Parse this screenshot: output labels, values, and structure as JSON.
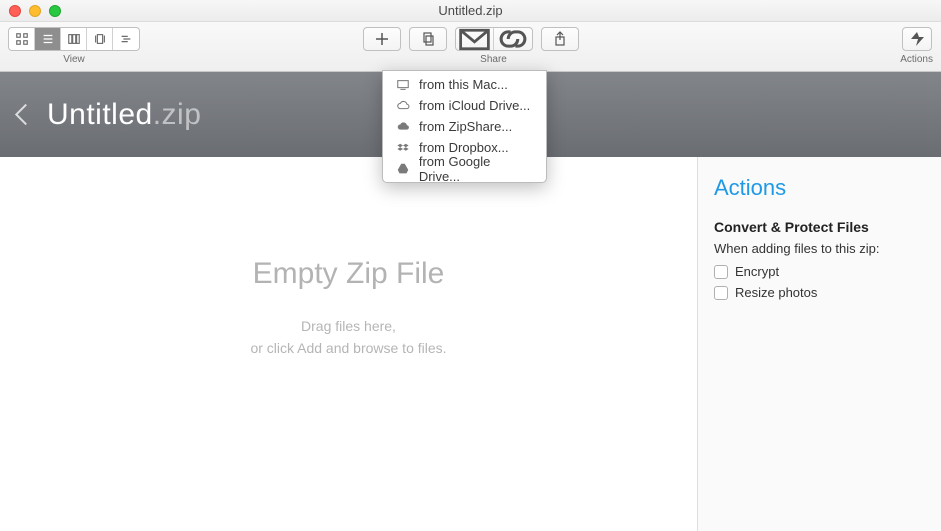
{
  "window_title": "Untitled.zip",
  "toolbar": {
    "view_label": "View",
    "share_label": "Share",
    "actions_label": "Actions"
  },
  "add_menu": {
    "items": [
      {
        "label": "from this Mac...",
        "icon": "monitor"
      },
      {
        "label": "from iCloud Drive...",
        "icon": "cloud"
      },
      {
        "label": "from ZipShare...",
        "icon": "cloud-solid"
      },
      {
        "label": "from Dropbox...",
        "icon": "dropbox"
      },
      {
        "label": "from Google Drive...",
        "icon": "gdrive"
      }
    ]
  },
  "breadcrumb": {
    "name": "Untitled",
    "ext": ".zip"
  },
  "empty": {
    "title": "Empty Zip File",
    "line1": "Drag files here,",
    "line2": "or click Add and browse to files."
  },
  "actions_panel": {
    "title": "Actions",
    "section": "Convert & Protect Files",
    "subtitle": "When adding files to this zip:",
    "options": [
      "Encrypt",
      "Resize photos"
    ]
  }
}
